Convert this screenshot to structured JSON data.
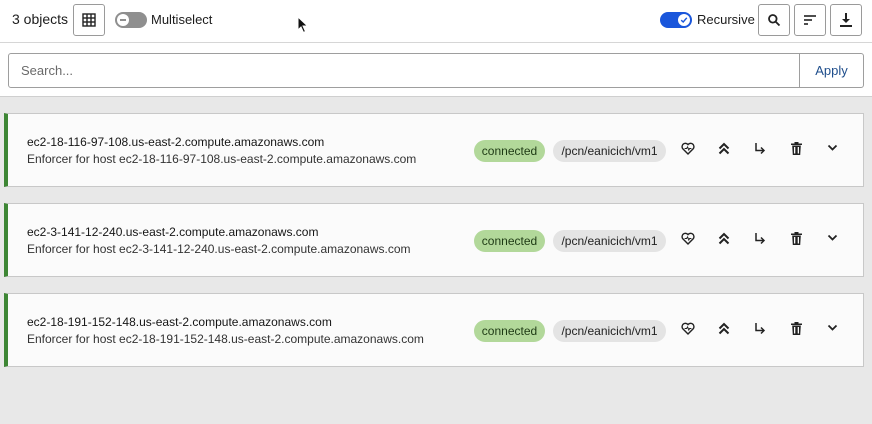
{
  "toolbar": {
    "count_label": "3 objects",
    "multiselect_label": "Multiselect",
    "recursive_label": "Recursive",
    "multiselect_on": false,
    "recursive_on": true
  },
  "search": {
    "placeholder": "Search...",
    "value": "",
    "apply_label": "Apply"
  },
  "colors": {
    "accent": "#1a56db",
    "status_connected": "#b2d89a",
    "card_border_left": "#3e8635",
    "namespace_bg": "#e4e4e4"
  },
  "icons": [
    "grid-icon",
    "search-icon",
    "sort-icon",
    "download-icon",
    "heart-icon",
    "chevrons-up-icon",
    "arrow-turn-right-icon",
    "trash-icon",
    "chevron-down-icon"
  ],
  "items": [
    {
      "name": "ec2-18-116-97-108.us-east-2.compute.amazonaws.com",
      "description": "Enforcer for host ec2-18-116-97-108.us-east-2.compute.amazonaws.com",
      "status": "connected",
      "namespace": "/pcn/eanicich/vm1"
    },
    {
      "name": "ec2-3-141-12-240.us-east-2.compute.amazonaws.com",
      "description": "Enforcer for host ec2-3-141-12-240.us-east-2.compute.amazonaws.com",
      "status": "connected",
      "namespace": "/pcn/eanicich/vm1"
    },
    {
      "name": "ec2-18-191-152-148.us-east-2.compute.amazonaws.com",
      "description": "Enforcer for host ec2-18-191-152-148.us-east-2.compute.amazonaws.com",
      "status": "connected",
      "namespace": "/pcn/eanicich/vm1"
    }
  ]
}
